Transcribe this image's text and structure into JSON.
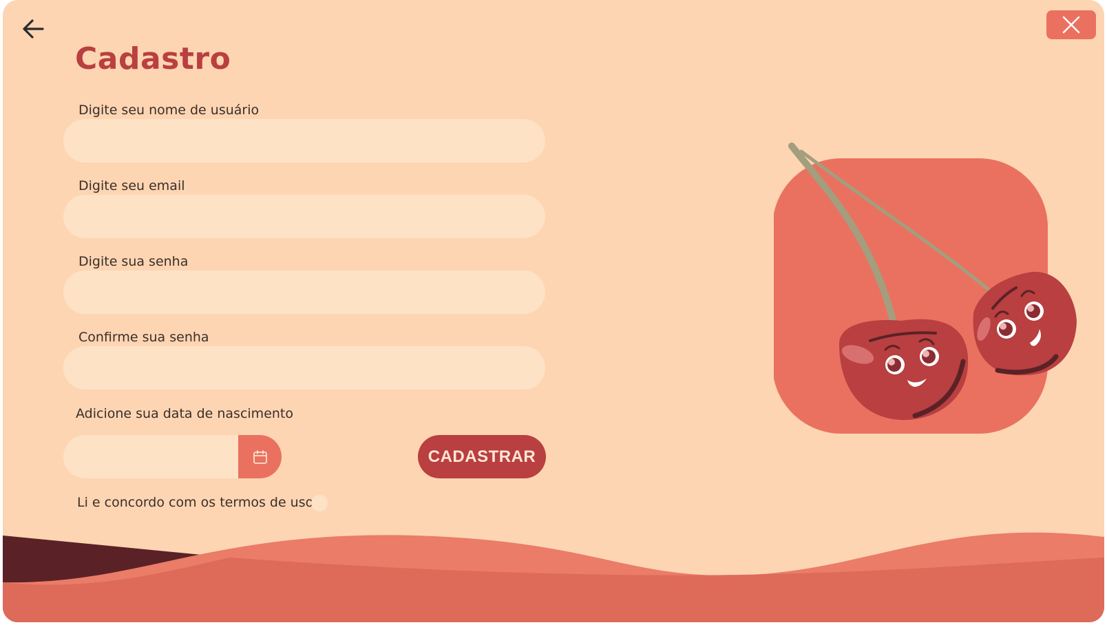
{
  "page": {
    "title": "Cadastro"
  },
  "form": {
    "username": {
      "label": "Digite seu nome de usuário",
      "value": "",
      "placeholder": ""
    },
    "email": {
      "label": "Digite seu email",
      "value": "",
      "placeholder": ""
    },
    "password": {
      "label": "Digite sua senha",
      "value": "",
      "placeholder": ""
    },
    "confirm_password": {
      "label": "Confirme sua senha",
      "value": "",
      "placeholder": ""
    },
    "birthdate": {
      "label": "Adicione sua data de nascimento",
      "value": "",
      "placeholder": ""
    },
    "terms": {
      "label": "Li e concordo com os termos de uso",
      "checked": false
    },
    "submit_label": "CADASTRAR"
  },
  "icons": {
    "back": "arrow-left-icon",
    "close": "close-icon",
    "calendar": "calendar-icon"
  },
  "colors": {
    "background": "#fdd5b2",
    "input": "#fee2c6",
    "accent": "#ea7160",
    "primary": "#b93f40",
    "text": "#3b2e2a",
    "dark_wave": "#5a2226"
  }
}
